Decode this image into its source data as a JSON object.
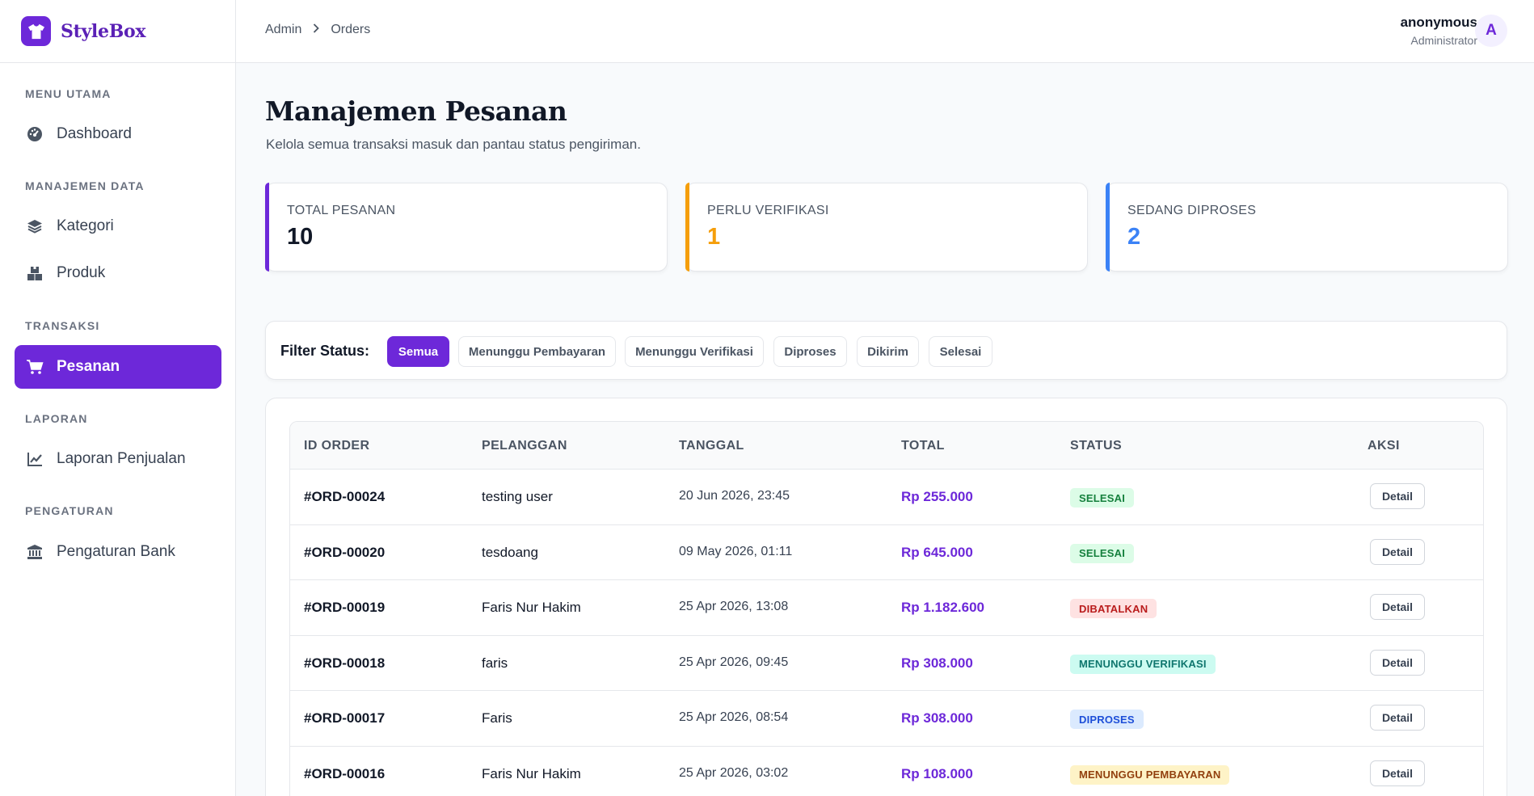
{
  "brand": {
    "name": "StyleBox",
    "logo_icon": "shirt-icon"
  },
  "sidebar": {
    "sections": [
      {
        "title": "MENU UTAMA"
      },
      {
        "title": "MANAJEMEN DATA"
      },
      {
        "title": "TRANSAKSI"
      },
      {
        "title": "LAPORAN"
      },
      {
        "title": "PENGATURAN"
      }
    ],
    "items": [
      {
        "label": "Dashboard",
        "icon": "gauge-icon"
      },
      {
        "label": "Kategori",
        "icon": "layers-icon"
      },
      {
        "label": "Produk",
        "icon": "boxes-icon"
      },
      {
        "label": "Pesanan",
        "icon": "cart-icon",
        "active": true
      },
      {
        "label": "Laporan Penjualan",
        "icon": "chart-line-icon"
      },
      {
        "label": "Pengaturan Bank",
        "icon": "bank-icon"
      }
    ]
  },
  "header": {
    "breadcrumb": [
      "Admin",
      "Orders"
    ],
    "user": {
      "name": "anonymous",
      "role": "Administrator",
      "initial": "A"
    }
  },
  "page": {
    "title": "Manajemen Pesanan",
    "subtitle": "Kelola semua transaksi masuk dan pantau status pengiriman."
  },
  "stats": [
    {
      "label": "TOTAL PESANAN",
      "value": "10",
      "accent": "#6d28d9",
      "value_color": "#111827"
    },
    {
      "label": "PERLU VERIFIKASI",
      "value": "1",
      "accent": "#f59e0b",
      "value_color": "#f59e0b"
    },
    {
      "label": "SEDANG DIPROSES",
      "value": "2",
      "accent": "#3b82f6",
      "value_color": "#3b82f6"
    }
  ],
  "filter": {
    "label": "Filter Status:",
    "options": [
      "Semua",
      "Menunggu Pembayaran",
      "Menunggu Verifikasi",
      "Diproses",
      "Dikirim",
      "Selesai"
    ],
    "selected": "Semua"
  },
  "table": {
    "columns": [
      "ID ORDER",
      "PELANGGAN",
      "TANGGAL",
      "TOTAL",
      "STATUS",
      "AKSI"
    ],
    "action_label": "Detail",
    "rows": [
      {
        "id": "#ORD-00024",
        "customer": "testing user",
        "date": "20 Jun 2026, 23:45",
        "total": "Rp 255.000",
        "status": "SELESAI",
        "status_bg": "#dcfce7",
        "status_fg": "#15803d"
      },
      {
        "id": "#ORD-00020",
        "customer": "tesdoang",
        "date": "09 May 2026, 01:11",
        "total": "Rp 645.000",
        "status": "SELESAI",
        "status_bg": "#dcfce7",
        "status_fg": "#15803d"
      },
      {
        "id": "#ORD-00019",
        "customer": "Faris Nur Hakim",
        "date": "25 Apr 2026, 13:08",
        "total": "Rp 1.182.600",
        "status": "DIBATALKAN",
        "status_bg": "#fee2e2",
        "status_fg": "#b91c1c"
      },
      {
        "id": "#ORD-00018",
        "customer": "faris",
        "date": "25 Apr 2026, 09:45",
        "total": "Rp 308.000",
        "status": "MENUNGGU VERIFIKASI",
        "status_bg": "#ccfbf1",
        "status_fg": "#0f766e"
      },
      {
        "id": "#ORD-00017",
        "customer": "Faris",
        "date": "25 Apr 2026, 08:54",
        "total": "Rp 308.000",
        "status": "DIPROSES",
        "status_bg": "#dbeafe",
        "status_fg": "#1d4ed8"
      },
      {
        "id": "#ORD-00016",
        "customer": "Faris Nur Hakim",
        "date": "25 Apr 2026, 03:02",
        "total": "Rp 108.000",
        "status": "MENUNGGU PEMBAYARAN",
        "status_bg": "#fef3c7",
        "status_fg": "#92400e"
      }
    ]
  }
}
